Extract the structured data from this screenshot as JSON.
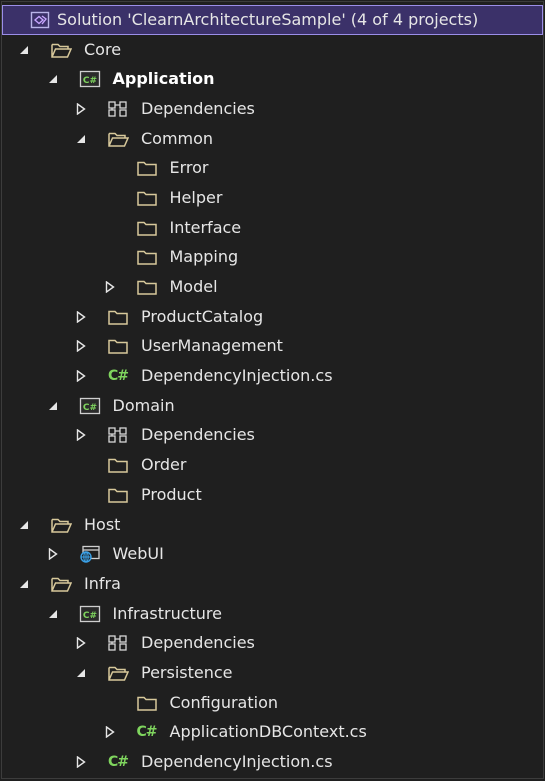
{
  "solution": {
    "label": "Solution 'ClearnArchitectureSample' (4 of 4 projects)"
  },
  "colors": {
    "selection_bg": "#3b3169",
    "selection_border": "#9b8ee8",
    "folder": "#d8c99b",
    "csharp": "#7fd55e",
    "web": "#3aa0e6"
  },
  "tree": [
    {
      "label": "Core",
      "depth": 1,
      "toggle": "expanded",
      "icon": "folder-open-icon"
    },
    {
      "label": "Application",
      "depth": 2,
      "toggle": "expanded",
      "icon": "csharp-project-icon",
      "bold": true
    },
    {
      "label": "Dependencies",
      "depth": 3,
      "toggle": "collapsed",
      "icon": "dependencies-icon"
    },
    {
      "label": "Common",
      "depth": 3,
      "toggle": "expanded",
      "icon": "folder-open-icon"
    },
    {
      "label": "Error",
      "depth": 4,
      "toggle": "none",
      "icon": "folder-icon"
    },
    {
      "label": "Helper",
      "depth": 4,
      "toggle": "none",
      "icon": "folder-icon"
    },
    {
      "label": "Interface",
      "depth": 4,
      "toggle": "none",
      "icon": "folder-icon"
    },
    {
      "label": "Mapping",
      "depth": 4,
      "toggle": "none",
      "icon": "folder-icon"
    },
    {
      "label": "Model",
      "depth": 4,
      "toggle": "collapsed",
      "icon": "folder-icon"
    },
    {
      "label": "ProductCatalog",
      "depth": 3,
      "toggle": "collapsed",
      "icon": "folder-icon"
    },
    {
      "label": "UserManagement",
      "depth": 3,
      "toggle": "collapsed",
      "icon": "folder-icon"
    },
    {
      "label": "DependencyInjection.cs",
      "depth": 3,
      "toggle": "collapsed",
      "icon": "csharp-file-icon"
    },
    {
      "label": "Domain",
      "depth": 2,
      "toggle": "expanded",
      "icon": "csharp-project-icon"
    },
    {
      "label": "Dependencies",
      "depth": 3,
      "toggle": "collapsed",
      "icon": "dependencies-icon"
    },
    {
      "label": "Order",
      "depth": 3,
      "toggle": "none",
      "icon": "folder-icon"
    },
    {
      "label": "Product",
      "depth": 3,
      "toggle": "none",
      "icon": "folder-icon"
    },
    {
      "label": "Host",
      "depth": 1,
      "toggle": "expanded",
      "icon": "folder-open-icon"
    },
    {
      "label": "WebUI",
      "depth": 2,
      "toggle": "collapsed",
      "icon": "web-project-icon"
    },
    {
      "label": "Infra",
      "depth": 1,
      "toggle": "expanded",
      "icon": "folder-open-icon"
    },
    {
      "label": "Infrastructure",
      "depth": 2,
      "toggle": "expanded",
      "icon": "csharp-project-icon"
    },
    {
      "label": "Dependencies",
      "depth": 3,
      "toggle": "collapsed",
      "icon": "dependencies-icon"
    },
    {
      "label": "Persistence",
      "depth": 3,
      "toggle": "expanded",
      "icon": "folder-open-icon"
    },
    {
      "label": "Configuration",
      "depth": 4,
      "toggle": "none",
      "icon": "folder-icon"
    },
    {
      "label": "ApplicationDBContext.cs",
      "depth": 4,
      "toggle": "collapsed",
      "icon": "csharp-file-icon"
    },
    {
      "label": "DependencyInjection.cs",
      "depth": 3,
      "toggle": "collapsed",
      "icon": "csharp-file-icon"
    }
  ]
}
